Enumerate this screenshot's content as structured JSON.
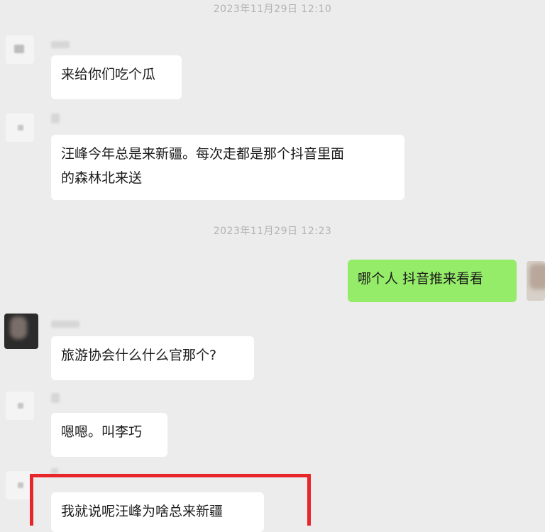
{
  "chat": {
    "timestamps": [
      "2023年11月29日 12:10",
      "2023年11月29日 12:23"
    ],
    "messages": [
      {
        "side": "left",
        "text": "来给你们吃个瓜"
      },
      {
        "side": "left",
        "text_lines": [
          "汪峰今年总是来新疆。每次走都是那个抖音里面",
          "的森林北来送"
        ]
      },
      {
        "side": "right",
        "text": "哪个人 抖音推来看看"
      },
      {
        "side": "left",
        "text": "旅游协会什么什么官那个?"
      },
      {
        "side": "left",
        "text": "嗯嗯。叫李巧"
      },
      {
        "side": "left",
        "text": "我就说呢汪峰为啥总来新疆",
        "highlighted": true
      }
    ]
  },
  "colors": {
    "background": "#ececec",
    "incoming_bubble": "#ffffff",
    "outgoing_bubble": "#95ec69",
    "highlight_box": "#e8262a",
    "timestamp_text": "#b3b3b3"
  }
}
